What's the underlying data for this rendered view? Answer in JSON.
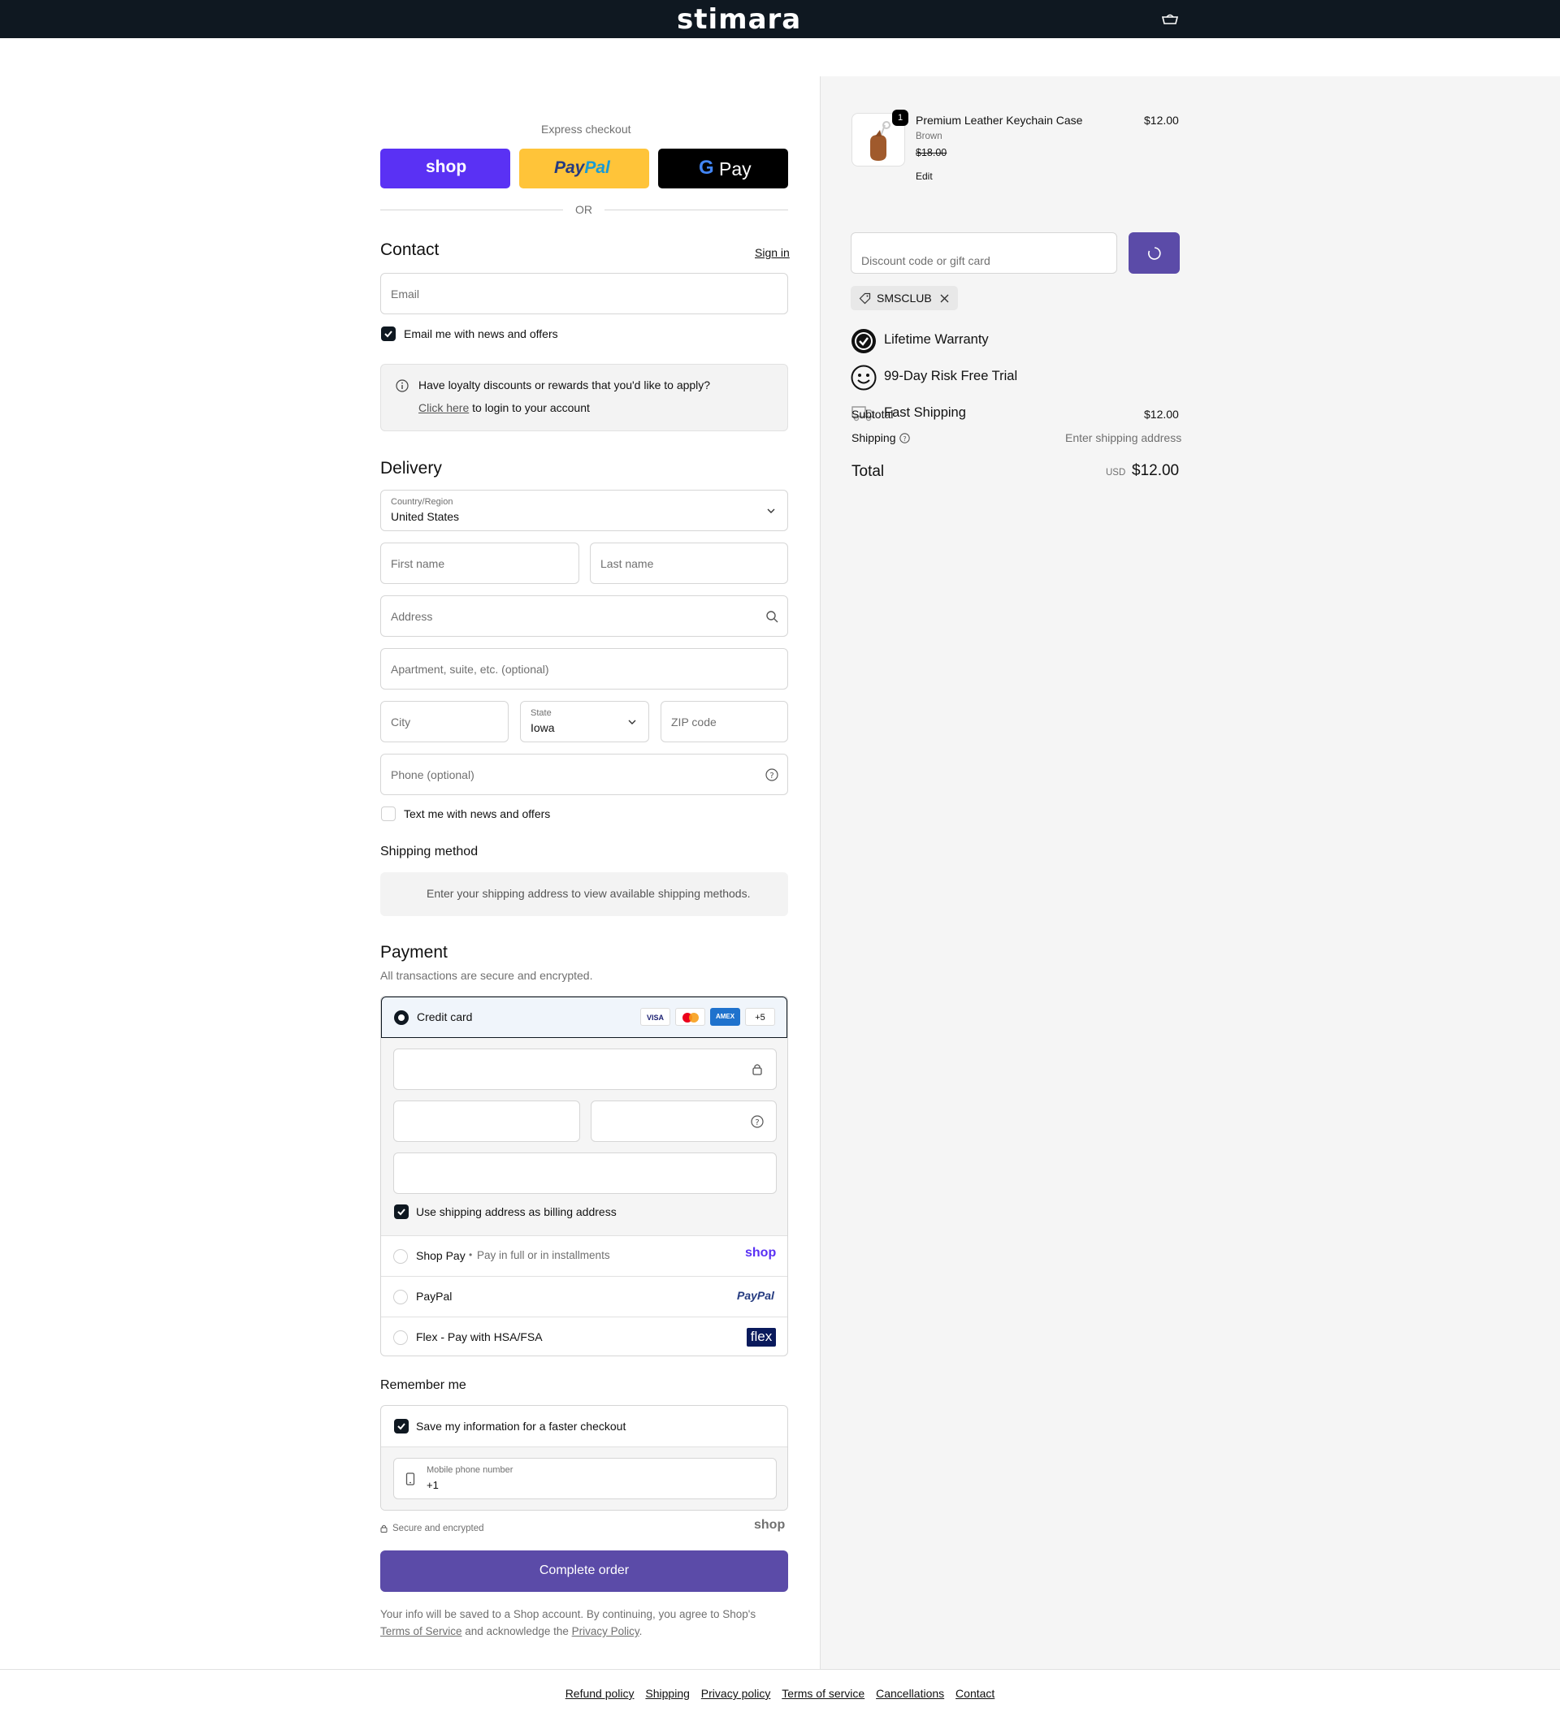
{
  "header": {
    "logo": "stimara",
    "cart_icon": "cart-icon"
  },
  "express": {
    "label": "Express checkout",
    "shop_label": "shop",
    "paypal_label_1": "Pay",
    "paypal_label_2": "Pal",
    "gpay_label": "Pay",
    "or": "OR"
  },
  "contact": {
    "title": "Contact",
    "sign_in": "Sign in",
    "email_placeholder": "Email",
    "news_label": "Email me with news and offers",
    "loyalty_question": "Have loyalty discounts or rewards that you'd like to apply?",
    "loyalty_link": "Click here",
    "loyalty_suffix": " to login to your account"
  },
  "delivery": {
    "title": "Delivery",
    "country_label": "Country/Region",
    "country_value": "United States",
    "first_name": "First name",
    "last_name": "Last name",
    "address": "Address",
    "apartment": "Apartment, suite, etc. (optional)",
    "city": "City",
    "state_label": "State",
    "state_value": "Iowa",
    "zip": "ZIP code",
    "phone": "Phone (optional)",
    "text_label": "Text me with news and offers"
  },
  "shipping_method": {
    "title": "Shipping method",
    "message": "Enter your shipping address to view available shipping methods."
  },
  "payment": {
    "title": "Payment",
    "subtitle": "All transactions are secure and encrypted.",
    "credit_card": "Credit card",
    "cards": [
      "VISA",
      "AMEX"
    ],
    "more_cards": "+5",
    "billing_label": "Use shipping address as billing address",
    "shop_pay": "Shop Pay",
    "shop_pay_note": "Pay in full or in installments",
    "shop_pay_logo": "shop",
    "paypal": "PayPal",
    "paypal_logo": "PayPal",
    "flex": "Flex - Pay with HSA/FSA",
    "flex_logo": "flex"
  },
  "remember": {
    "title": "Remember me",
    "save_label": "Save my information for a faster checkout",
    "mobile_label": "Mobile phone number",
    "mobile_value": "+1",
    "secure": "Secure and encrypted",
    "shop_logo": "shop"
  },
  "complete_button": "Complete order",
  "disclaimer": {
    "line1": "Your info will be saved to a Shop account. By continuing, you agree to Shop's",
    "terms": "Terms of Service",
    "middle": " and acknowledge the ",
    "privacy": "Privacy Policy",
    "end": "."
  },
  "order": {
    "qty": "1",
    "product_name": "Premium Leather Keychain Case",
    "variant": "Brown",
    "compare_price": "$18.00",
    "edit": "Edit",
    "price": "$12.00",
    "discount_placeholder": "Discount code or gift card",
    "discount_code": "SMSCLUB",
    "perk1": "Lifetime Warranty",
    "perk2": "99-Day Risk Free Trial",
    "perk3": "Fast Shipping",
    "subtotal_label": "Subtotal",
    "subtotal_value": "$12.00",
    "shipping_label": "Shipping",
    "shipping_value": "Enter shipping address",
    "total_label": "Total",
    "currency": "USD",
    "total_value": "$12.00"
  },
  "footer_links": [
    "Refund policy",
    "Shipping",
    "Privacy policy",
    "Terms of service",
    "Cancellations",
    "Contact"
  ],
  "colors": {
    "accent": "#5b4ba8",
    "shop_purple": "#5a31f4",
    "paypal_yellow": "#ffc439",
    "dark": "#0f1821"
  }
}
